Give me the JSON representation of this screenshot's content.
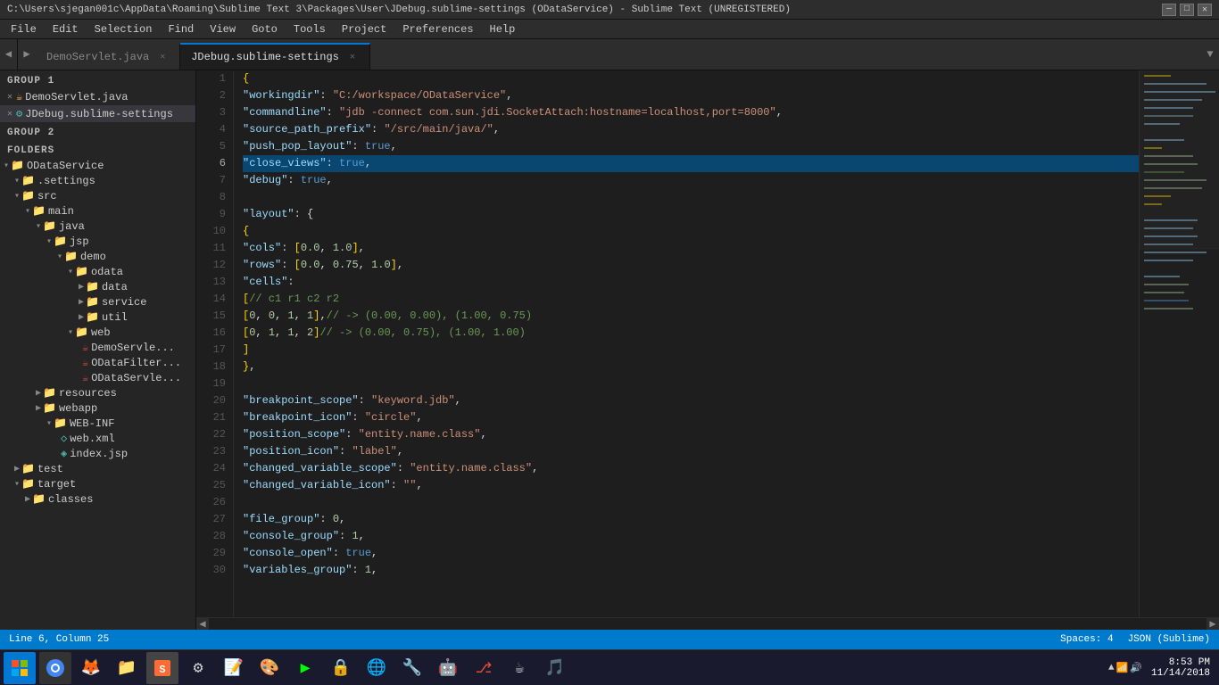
{
  "titlebar": {
    "text": "C:\\Users\\sjegan001c\\AppData\\Roaming\\Sublime Text 3\\Packages\\User\\JDebug.sublime-settings (ODataService) - Sublime Text (UNREGISTERED)",
    "minimize": "—",
    "maximize": "□",
    "close": "✕"
  },
  "menu": {
    "items": [
      "File",
      "Edit",
      "Selection",
      "Find",
      "View",
      "Goto",
      "Tools",
      "Project",
      "Preferences",
      "Help"
    ]
  },
  "tabs": [
    {
      "label": "DemoServlet.java",
      "active": false,
      "closeable": true
    },
    {
      "label": "JDebug.sublime-settings",
      "active": true,
      "closeable": true
    }
  ],
  "sidebar": {
    "group1": "GROUP 1",
    "group1files": [
      {
        "name": "DemoServlet.java",
        "active": false
      },
      {
        "name": "JDebug.sublime-settings",
        "active": true
      }
    ],
    "group2": "GROUP 2",
    "folders": "FOLDERS",
    "tree": [
      {
        "indent": 0,
        "type": "folder",
        "open": true,
        "name": "ODataService"
      },
      {
        "indent": 1,
        "type": "folder",
        "open": true,
        "name": ".settings"
      },
      {
        "indent": 1,
        "type": "folder",
        "open": true,
        "name": "src"
      },
      {
        "indent": 2,
        "type": "folder",
        "open": true,
        "name": "main"
      },
      {
        "indent": 3,
        "type": "folder",
        "open": true,
        "name": "java"
      },
      {
        "indent": 4,
        "type": "folder",
        "open": true,
        "name": "jsp"
      },
      {
        "indent": 5,
        "type": "folder",
        "open": true,
        "name": "demo"
      },
      {
        "indent": 6,
        "type": "folder",
        "open": true,
        "name": "odata"
      },
      {
        "indent": 7,
        "type": "folder",
        "open": false,
        "name": "data"
      },
      {
        "indent": 7,
        "type": "folder",
        "open": false,
        "name": "service"
      },
      {
        "indent": 7,
        "type": "folder",
        "open": false,
        "name": "util"
      },
      {
        "indent": 6,
        "type": "folder",
        "open": true,
        "name": "web"
      },
      {
        "indent": 7,
        "type": "java",
        "name": "DemoServle..."
      },
      {
        "indent": 7,
        "type": "java",
        "name": "ODataFilter..."
      },
      {
        "indent": 7,
        "type": "java",
        "name": "ODataServle..."
      },
      {
        "indent": 3,
        "type": "folder",
        "open": false,
        "name": "resources"
      },
      {
        "indent": 3,
        "type": "folder",
        "open": false,
        "name": "webapp"
      },
      {
        "indent": 4,
        "type": "folder",
        "open": true,
        "name": "WEB-INF"
      },
      {
        "indent": 5,
        "type": "xml",
        "name": "web.xml"
      },
      {
        "indent": 5,
        "type": "jsp",
        "name": "index.jsp"
      },
      {
        "indent": 1,
        "type": "folder",
        "open": false,
        "name": "test"
      },
      {
        "indent": 1,
        "type": "folder",
        "open": true,
        "name": "target"
      },
      {
        "indent": 2,
        "type": "folder",
        "open": false,
        "name": "classes"
      }
    ]
  },
  "code": {
    "lines": [
      {
        "num": 1,
        "highlighted": false,
        "content": "{"
      },
      {
        "num": 2,
        "highlighted": false,
        "content": "    \"workingdir\": \"C:/workspace/ODataService\","
      },
      {
        "num": 3,
        "highlighted": false,
        "content": "    \"commandline\": \"jdb -connect com.sun.jdi.SocketAttach:hostname=localhost,port=8000\","
      },
      {
        "num": 4,
        "highlighted": false,
        "content": "    \"source_path_prefix\": \"/src/main/java/\","
      },
      {
        "num": 5,
        "highlighted": false,
        "content": "    \"push_pop_layout\": true,"
      },
      {
        "num": 6,
        "highlighted": true,
        "content": "    \"close_views\": true,"
      },
      {
        "num": 7,
        "highlighted": false,
        "content": "    \"debug\": true,"
      },
      {
        "num": 8,
        "highlighted": false,
        "content": ""
      },
      {
        "num": 9,
        "highlighted": false,
        "content": "    \"layout\": {"
      },
      {
        "num": 10,
        "highlighted": false,
        "content": "    {"
      },
      {
        "num": 11,
        "highlighted": false,
        "content": "        \"cols\": [0.0, 1.0],"
      },
      {
        "num": 12,
        "highlighted": false,
        "content": "        \"rows\": [0.0, 0.75, 1.0],"
      },
      {
        "num": 13,
        "highlighted": false,
        "content": "        \"cells\":"
      },
      {
        "num": 14,
        "highlighted": false,
        "content": "        [ // c1 r1 c2 r2"
      },
      {
        "num": 15,
        "highlighted": false,
        "content": "            [0, 0, 1, 1], // -> (0.00, 0.00), (1.00, 0.75)"
      },
      {
        "num": 16,
        "highlighted": false,
        "content": "            [0, 1, 1, 2]  // -> (0.00, 0.75), (1.00, 1.00)"
      },
      {
        "num": 17,
        "highlighted": false,
        "content": "        ]"
      },
      {
        "num": 18,
        "highlighted": false,
        "content": "    },"
      },
      {
        "num": 19,
        "highlighted": false,
        "content": ""
      },
      {
        "num": 20,
        "highlighted": false,
        "content": "    \"breakpoint_scope\": \"keyword.jdb\","
      },
      {
        "num": 21,
        "highlighted": false,
        "content": "    \"breakpoint_icon\": \"circle\","
      },
      {
        "num": 22,
        "highlighted": false,
        "content": "    \"position_scope\": \"entity.name.class\","
      },
      {
        "num": 23,
        "highlighted": false,
        "content": "    \"position_icon\": \"label\","
      },
      {
        "num": 24,
        "highlighted": false,
        "content": "    \"changed_variable_scope\": \"entity.name.class\","
      },
      {
        "num": 25,
        "highlighted": false,
        "content": "    \"changed_variable_icon\": \"\","
      },
      {
        "num": 26,
        "highlighted": false,
        "content": ""
      },
      {
        "num": 27,
        "highlighted": false,
        "content": "    \"file_group\": 0,"
      },
      {
        "num": 28,
        "highlighted": false,
        "content": "    \"console_group\": 1,"
      },
      {
        "num": 29,
        "highlighted": false,
        "content": "    \"console_open\": true,"
      },
      {
        "num": 30,
        "highlighted": false,
        "content": "    \"variables_group\": 1,"
      }
    ]
  },
  "statusbar": {
    "left": "Line 6, Column 25",
    "spaces": "Spaces: 4",
    "syntax": "JSON (Sublime)"
  },
  "taskbar": {
    "time": "8:53 PM",
    "date": "11/14/2018"
  }
}
